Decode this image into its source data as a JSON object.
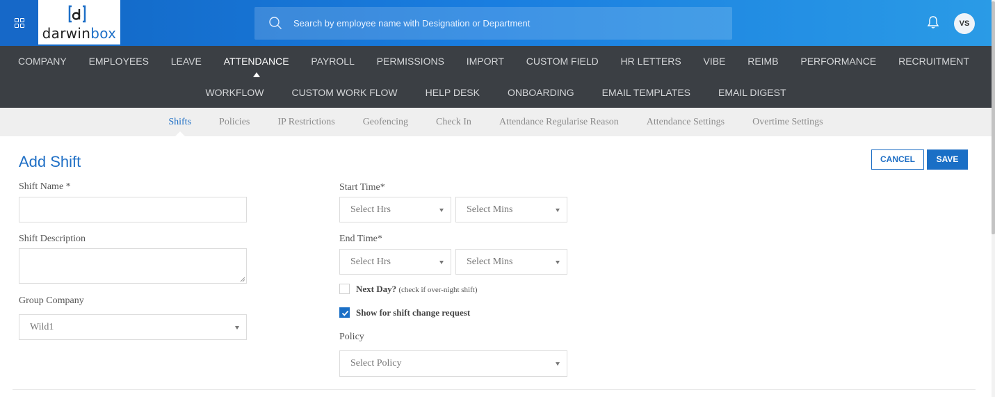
{
  "header": {
    "logo_prefix": "darwin",
    "logo_suffix": "box",
    "search_placeholder": "Search by employee name with Designation or Department",
    "avatar_initials": "VS"
  },
  "main_nav": {
    "row1": [
      "COMPANY",
      "EMPLOYEES",
      "LEAVE",
      "ATTENDANCE",
      "PAYROLL",
      "PERMISSIONS",
      "IMPORT",
      "CUSTOM FIELD",
      "HR LETTERS",
      "VIBE",
      "REIMB",
      "PERFORMANCE",
      "RECRUITMENT"
    ],
    "row2": [
      "WORKFLOW",
      "CUSTOM WORK FLOW",
      "HELP DESK",
      "ONBOARDING",
      "EMAIL TEMPLATES",
      "EMAIL DIGEST"
    ],
    "active": "ATTENDANCE"
  },
  "sub_nav": {
    "items": [
      "Shifts",
      "Policies",
      "IP Restrictions",
      "Geofencing",
      "Check In",
      "Attendance Regularise Reason",
      "Attendance Settings",
      "Overtime Settings"
    ],
    "active": "Shifts"
  },
  "form": {
    "title": "Add Shift",
    "cancel_label": "CANCEL",
    "save_label": "SAVE",
    "shift_name_label": "Shift Name *",
    "shift_name_value": "",
    "shift_description_label": "Shift Description",
    "shift_description_value": "",
    "group_company_label": "Group Company",
    "group_company_value": "Wild1",
    "start_time_label": "Start Time*",
    "start_hrs": "Select Hrs",
    "start_mins": "Select Mins",
    "end_time_label": "End Time*",
    "end_hrs": "Select Hrs",
    "end_mins": "Select Mins",
    "next_day_label": "Next Day?",
    "next_day_hint": "(check if over-night shift)",
    "next_day_checked": false,
    "show_shift_change_label": "Show for shift change request",
    "show_shift_change_checked": true,
    "policy_label": "Policy",
    "policy_value": "Select Policy"
  },
  "colors": {
    "brand_blue": "#1a6fc6",
    "nav_bg": "#3b3f44",
    "subnav_bg": "#efefef"
  }
}
